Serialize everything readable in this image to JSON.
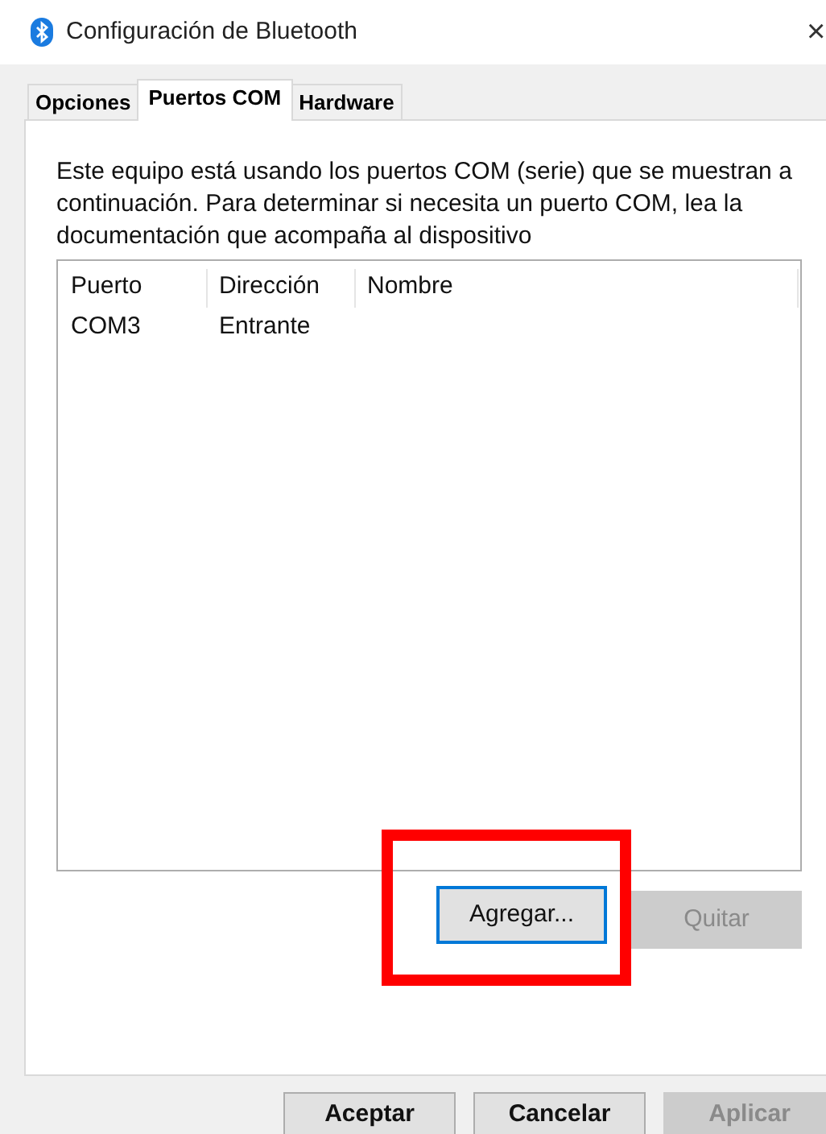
{
  "window": {
    "title": "Configuración de Bluetooth",
    "close": "×"
  },
  "tabs": [
    {
      "label": "Opciones",
      "selected": false
    },
    {
      "label": "Puertos COM",
      "selected": true
    },
    {
      "label": "Hardware",
      "selected": false
    }
  ],
  "description": "Este equipo está usando los puertos COM (serie) que se muestran a continuación. Para determinar si necesita un puerto COM, lea la documentación que acompaña al dispositivo",
  "table": {
    "columns": [
      "Puerto",
      "Dirección",
      "Nombre"
    ],
    "rows": [
      [
        "COM3",
        "Entrante",
        ""
      ]
    ]
  },
  "list_buttons": [
    {
      "label": "Agregar...",
      "disabled": false,
      "focused": true,
      "highlighted": true
    },
    {
      "label": "Quitar",
      "disabled": true,
      "focused": false,
      "highlighted": false
    }
  ],
  "dialog_buttons": [
    {
      "label": "Aceptar",
      "disabled": false
    },
    {
      "label": "Cancelar",
      "disabled": false
    },
    {
      "label": "Aplicar",
      "disabled": true
    }
  ]
}
